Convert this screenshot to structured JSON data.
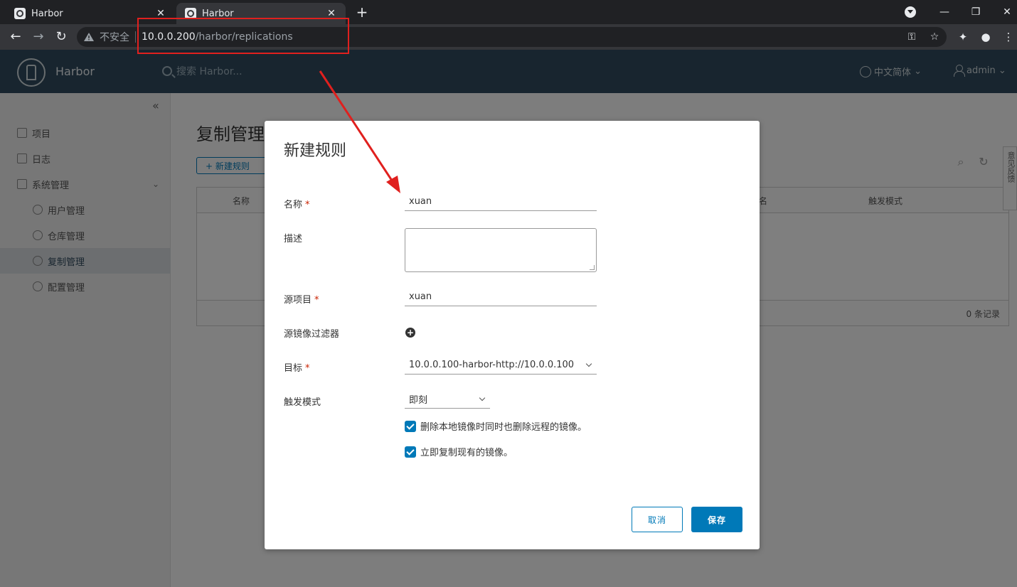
{
  "browser": {
    "tabs": [
      {
        "title": "Harbor",
        "close": "✕"
      },
      {
        "title": "Harbor",
        "close": "✕"
      }
    ],
    "new_tab": "+",
    "address": {
      "security_label": "不安全",
      "host": "10.0.0.200",
      "path": "/harbor/replications"
    }
  },
  "header": {
    "brand": "Harbor",
    "search_placeholder": "搜索 Harbor...",
    "language": "中文简体",
    "user": "admin"
  },
  "sidebar": {
    "collapse": "«",
    "items": [
      {
        "label": "项目"
      },
      {
        "label": "日志"
      },
      {
        "label": "系统管理"
      }
    ],
    "subitems": [
      {
        "label": "用户管理"
      },
      {
        "label": "仓库管理"
      },
      {
        "label": "复制管理"
      },
      {
        "label": "配置管理"
      }
    ]
  },
  "page": {
    "title": "复制管理",
    "new_rule_button": "+ 新建规则",
    "columns": [
      "名称",
      "名",
      "触发模式"
    ],
    "record_count": "0 条记录",
    "feedback": "意见反馈"
  },
  "modal": {
    "title": "新建规则",
    "name_label": "名称",
    "name_value": "xuan",
    "desc_label": "描述",
    "source_project_label": "源项目",
    "source_project_value": "xuan",
    "filter_label": "源镜像过滤器",
    "target_label": "目标",
    "target_value": "10.0.0.100-harbor-http://10.0.0.100",
    "trigger_label": "触发模式",
    "trigger_value": "即刻",
    "check_delete": "删除本地镜像时同时也删除远程的镜像。",
    "check_replicate": "立即复制现有的镜像。",
    "required_mark": "*",
    "cancel": "取消",
    "save": "保存"
  },
  "colors": {
    "header": "#314b5e",
    "accent": "#0079b8",
    "annotation": "#e0201e"
  }
}
